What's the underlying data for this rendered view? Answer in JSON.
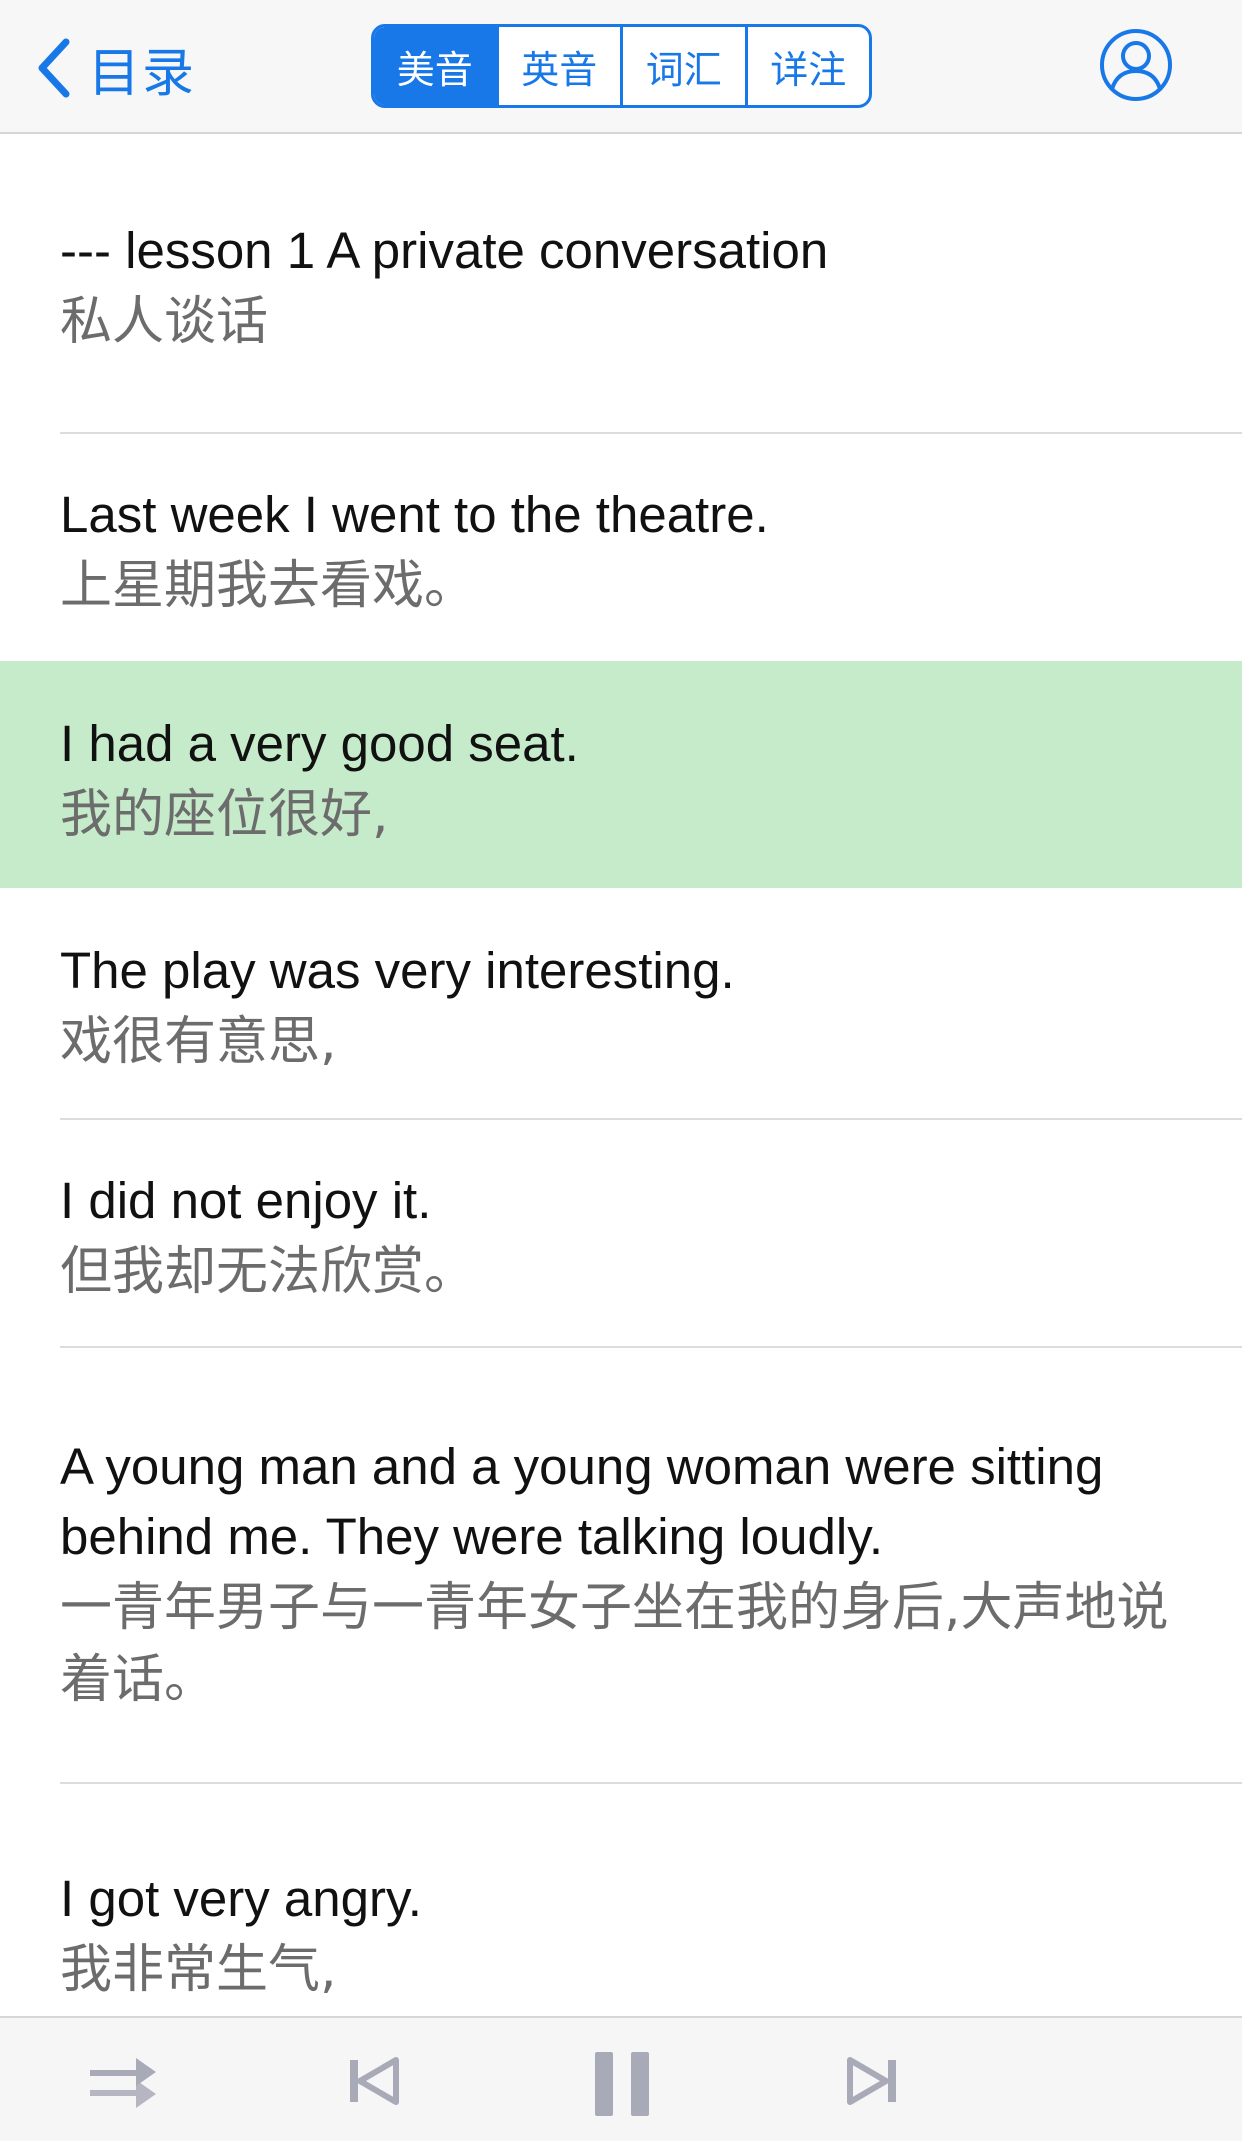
{
  "nav": {
    "back_label": "目录",
    "segments": [
      {
        "label": "美音",
        "active": true
      },
      {
        "label": "英音",
        "active": false
      },
      {
        "label": "词汇",
        "active": false
      },
      {
        "label": "详注",
        "active": false
      }
    ]
  },
  "sentences": [
    {
      "en": "--- lesson 1 A private conversation",
      "zh": "私人谈话",
      "highlighted": false
    },
    {
      "en": "Last week I went to the theatre.",
      "zh": "上星期我去看戏。",
      "highlighted": false
    },
    {
      "en": "I had a very good seat.",
      "zh": "我的座位很好,",
      "highlighted": true
    },
    {
      "en": "The play was very interesting.",
      "zh": "戏很有意思,",
      "highlighted": false
    },
    {
      "en": "I did not enjoy it.",
      "zh": "但我却无法欣赏。",
      "highlighted": false
    },
    {
      "en": "A young man and a young woman were sitting behind me. They were talking loudly.",
      "zh": "一青年男子与一青年女子坐在我的身后,大声地说着话。",
      "highlighted": false
    },
    {
      "en": "I got very angry.",
      "zh": "我非常生气,",
      "highlighted": false
    }
  ],
  "player": {
    "buttons": [
      "repeat-mode-icon",
      "previous-track-icon",
      "pause-icon",
      "next-track-icon"
    ]
  },
  "colors": {
    "accent": "#1878e8",
    "highlight": "#c6ebcb",
    "chinese_text": "#6c6c6c",
    "player_icon": "#a9aab8"
  }
}
